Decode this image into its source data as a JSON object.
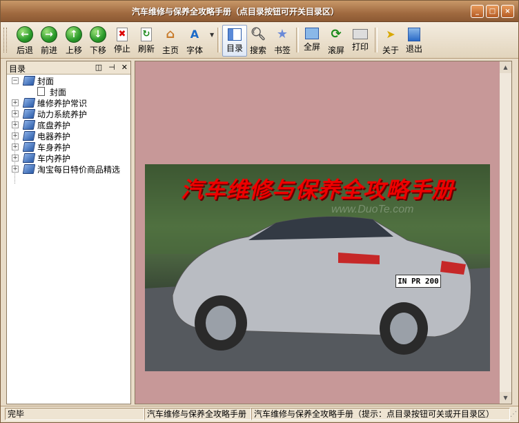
{
  "window": {
    "title": "汽车维修与保养全攻略手册（点目录按钮可开关目录区）"
  },
  "window_buttons": [
    "_",
    "□",
    "×"
  ],
  "toolbar": {
    "buttons": [
      {
        "label": "后退",
        "icon": "arrow-left-icon"
      },
      {
        "label": "前进",
        "icon": "arrow-right-icon"
      },
      {
        "label": "上移",
        "icon": "arrow-up-icon"
      },
      {
        "label": "下移",
        "icon": "arrow-down-icon"
      },
      {
        "label": "停止",
        "icon": "stop-icon"
      },
      {
        "label": "刷新",
        "icon": "refresh-icon"
      },
      {
        "label": "主页",
        "icon": "home-icon"
      },
      {
        "label": "字体",
        "icon": "font-icon"
      },
      {
        "label": "目录",
        "icon": "contents-icon"
      },
      {
        "label": "搜索",
        "icon": "search-icon"
      },
      {
        "label": "书签",
        "icon": "bookmark-icon"
      },
      {
        "label": "全屏",
        "icon": "fullscreen-icon"
      },
      {
        "label": "滚屏",
        "icon": "autoscroll-icon"
      },
      {
        "label": "打印",
        "icon": "print-icon"
      },
      {
        "label": "关于",
        "icon": "about-icon"
      },
      {
        "label": "退出",
        "icon": "exit-icon"
      }
    ]
  },
  "panel": {
    "title": "目录",
    "tree": [
      {
        "label": "封面",
        "expanded": true
      },
      {
        "label": "封面",
        "child": true
      },
      {
        "label": "維修养护常识"
      },
      {
        "label": "动力系統养护"
      },
      {
        "label": "底盘养护"
      },
      {
        "label": "电器养护"
      },
      {
        "label": "车身养护"
      },
      {
        "label": "车内养护"
      },
      {
        "label": "淘宝每日特价商品精选"
      }
    ]
  },
  "content": {
    "banner_text": "汽车维修与保养全攻略手册",
    "watermark": "www.DuoTe.com",
    "plate": "IN PR 200"
  },
  "status": {
    "left": "完毕",
    "middle": "汽车维修与保养全攻略手册",
    "right": "汽车维修与保养全攻略手册（提示：点目录按钮可关或开目录区）"
  },
  "colors": {
    "content_bg": "#c79898",
    "title_bar": "#a06a40"
  }
}
